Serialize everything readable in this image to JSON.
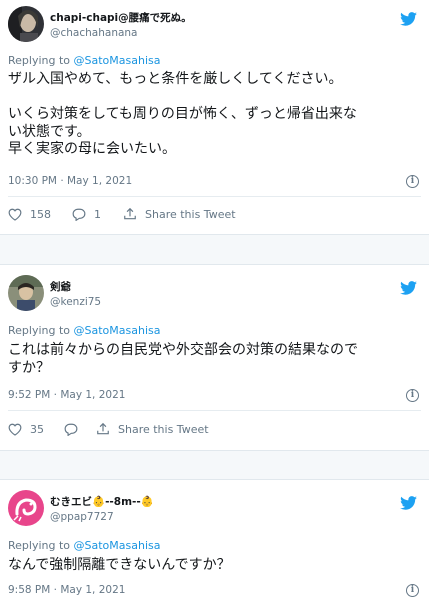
{
  "tweets": [
    {
      "name": "chapi-chapi@腰痛で死ぬ。",
      "handle": "@chachahanana",
      "replying_prefix": "Replying to ",
      "replying_to": "@SatoMasahisa",
      "text": "ザル入国やめて、もっと条件を厳しくしてください。\n\nいくら対策をしても周りの目が怖く、ずっと帰省出来な\nい状態です。\n早く実家の母に会いたい。",
      "time": "10:30 PM · May 1, 2021",
      "likes": "158",
      "replies": "1",
      "share": "Share this Tweet"
    },
    {
      "name": "剣爺",
      "handle": "@kenzi75",
      "replying_prefix": "Replying to ",
      "replying_to": "@SatoMasahisa",
      "text": "これは前々からの自民党や外交部会の対策の結果なので\nすか？",
      "time": "9:52 PM · May 1, 2021",
      "likes": "35",
      "replies": "",
      "share": "Share this Tweet"
    },
    {
      "name": "むきエビ👶‐‐8m‐‐👶",
      "handle": "@ppap7727",
      "replying_prefix": "Replying to ",
      "replying_to": "@SatoMasahisa",
      "text": "なんで強制隔離できないんですか？",
      "time": "9:58 PM · May 1, 2021"
    }
  ],
  "colors": {
    "twitter_blue": "#1da1f2",
    "mention_blue": "#1b95e0",
    "secondary_text": "#657786",
    "page_bg": "#f5f8fa"
  },
  "icons": [
    "twitter-bird-icon",
    "info-icon",
    "heart-icon",
    "reply-icon",
    "share-icon"
  ]
}
